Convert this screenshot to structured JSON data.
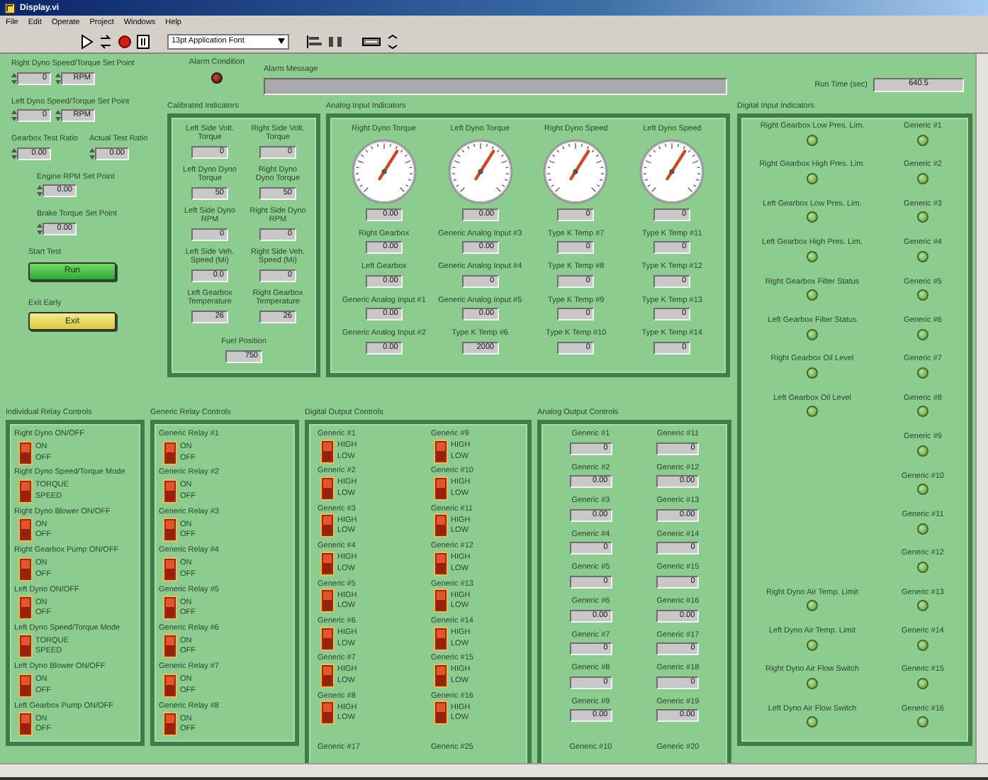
{
  "window": {
    "title": "Display.vi"
  },
  "menu": [
    "File",
    "Edit",
    "Operate",
    "Project",
    "Windows",
    "Help"
  ],
  "toolbar": {
    "font": "13pt Application Font"
  },
  "left_controls": [
    {
      "items": [
        {
          "label": "Right Dyno Speed/Torque Set Point",
          "fields": [
            "0",
            "RPM"
          ]
        }
      ]
    },
    {
      "items": [
        {
          "label": "Left Dyno Speed/Torque Set Point",
          "fields": [
            "0",
            "RPM"
          ]
        }
      ]
    },
    {
      "items": [
        {
          "label": "Gearbox Test Ratio",
          "fields": [
            "0.00"
          ]
        },
        {
          "label": "Actual Test Ratio",
          "fields": [
            "0.00"
          ]
        }
      ]
    },
    {
      "items": [
        {
          "label": "Engine RPM Set Point",
          "fields": [
            "0.00"
          ]
        }
      ]
    },
    {
      "items": [
        {
          "label": "Brake Torque Set Point",
          "fields": [
            "0.00"
          ]
        }
      ]
    }
  ],
  "start": {
    "label": "Start Test",
    "button": "Run"
  },
  "exit": {
    "label": "Exit Early",
    "button": "Exit"
  },
  "alarm": {
    "label": "Alarm Condition",
    "on": false
  },
  "alarm_message": {
    "label": "Alarm Message"
  },
  "run_time": {
    "label": "Run Time (sec)",
    "value": "640.5"
  },
  "calibrated": {
    "title": "Calibrated Indicators",
    "pairs": [
      [
        {
          "label": "Left Side Volt. Torque",
          "value": "0"
        },
        {
          "label": "Right Side Volt. Torque",
          "value": "0"
        }
      ],
      [
        {
          "label": "Left Dyno Dyno Torque",
          "value": "50"
        },
        {
          "label": "Right Dyno Dyno Torque",
          "value": "50"
        }
      ],
      [
        {
          "label": "Left Side Dyno RPM",
          "value": "0"
        },
        {
          "label": "Right Side Dyno RPM",
          "value": "0"
        }
      ],
      [
        {
          "label": "Left Side Veh. Speed (Mi)",
          "value": "0.0"
        },
        {
          "label": "Right Side Veh. Speed (Mi)",
          "value": "0"
        }
      ],
      [
        {
          "label": "Left Gearbox Temperature",
          "value": "26"
        },
        {
          "label": "Right Gearbox Temperature",
          "value": "26"
        }
      ]
    ],
    "footer": {
      "label": "Fuel Position",
      "value": "750"
    }
  },
  "analog_inputs": {
    "title": "Analog Input Indicators",
    "gauges": [
      {
        "label": "Right Dyno Torque",
        "value": "0.00"
      },
      {
        "label": "Left Dyno Torque",
        "value": "0.00"
      },
      {
        "label": "Right Dyno Speed",
        "value": "0"
      },
      {
        "label": "Left Dyno Speed",
        "value": "0"
      }
    ],
    "readouts": [
      {
        "label": "Right Gearbox",
        "value": "0.00"
      },
      {
        "label": "Generic Analog Input #3",
        "value": "0.00"
      },
      {
        "label": "Type K Temp #7",
        "value": "0"
      },
      {
        "label": "Type K Temp #11",
        "value": "0"
      },
      {
        "label": "Left Gearbox",
        "value": "0.00"
      },
      {
        "label": "Generic Analog Input #4",
        "value": "0"
      },
      {
        "label": "Type K Temp #8",
        "value": "0"
      },
      {
        "label": "Type K Temp #12",
        "value": "0"
      },
      {
        "label": "Generic Analog Input #1",
        "value": "0.00"
      },
      {
        "label": "Generic Analog Input #5",
        "value": "0.00"
      },
      {
        "label": "Type K Temp #9",
        "value": "0"
      },
      {
        "label": "Type K Temp #13",
        "value": "0"
      },
      {
        "label": "Generic Analog Input #2",
        "value": "0.00"
      },
      {
        "label": "Type K Temp #6",
        "value": "2000"
      },
      {
        "label": "Type K Temp #10",
        "value": "0"
      },
      {
        "label": "Type K Temp #14",
        "value": "0"
      }
    ]
  },
  "digital_inputs": {
    "title": "Digital Input Indicators",
    "rows": [
      {
        "left": {
          "label": "Right Gearbox Low Pres. Lim.",
          "on": false
        },
        "right": {
          "label": "Generic #1",
          "on": false
        }
      },
      {
        "left": {
          "label": "Right Gearbox High Pres. Lim.",
          "on": false
        },
        "right": {
          "label": "Generic #2",
          "on": false
        }
      },
      {
        "left": {
          "label": "Left Gearbox Low Pres. Lim.",
          "on": false
        },
        "right": {
          "label": "Generic #3",
          "on": false
        }
      },
      {
        "left": {
          "label": "Left Gearbox High Pres. Lim.",
          "on": false
        },
        "right": {
          "label": "Generic #4",
          "on": false
        }
      },
      {
        "left": {
          "label": "Right Gearbox Filter Status",
          "on": false
        },
        "right": {
          "label": "Generic #5",
          "on": false
        }
      },
      {
        "left": {
          "label": "Left Gearbox Filter Status",
          "on": false
        },
        "right": {
          "label": "Generic #6",
          "on": false
        }
      },
      {
        "left": {
          "label": "Right Gearbox Oil Level",
          "on": false
        },
        "right": {
          "label": "Generic #7",
          "on": false
        }
      },
      {
        "left": {
          "label": "Left Gearbox Oil Level",
          "on": false
        },
        "right": {
          "label": "Generic #8",
          "on": false
        }
      },
      {
        "right": {
          "label": "Generic #9",
          "on": false
        }
      },
      {
        "right": {
          "label": "Generic #10",
          "on": false
        }
      },
      {
        "right": {
          "label": "Generic #11",
          "on": false
        }
      },
      {
        "right": {
          "label": "Generic #12",
          "on": false
        }
      },
      {
        "left": {
          "label": "Right Dyno Air Temp. Limit",
          "on": false
        },
        "right": {
          "label": "Generic #13",
          "on": false
        }
      },
      {
        "left": {
          "label": "Left Dyno Air Temp. Limit",
          "on": false
        },
        "right": {
          "label": "Generic #14",
          "on": false
        }
      },
      {
        "left": {
          "label": "Right Dyno Air Flow Switch",
          "on": false
        },
        "right": {
          "label": "Generic #15",
          "on": false
        }
      },
      {
        "left": {
          "label": "Left Dyno Air Flow Switch",
          "on": false
        },
        "right": {
          "label": "Generic #16",
          "on": false
        }
      }
    ]
  },
  "individual_relays": {
    "title": "Individual Relay Controls",
    "items": [
      {
        "label": "Right Dyno ON/OFF",
        "on_text": "ON",
        "off_text": "OFF",
        "on": false
      },
      {
        "label": "Right Dyno Speed/Torque Mode",
        "on_text": "TORQUE",
        "off_text": "SPEED",
        "on": false
      },
      {
        "label": "Right Dyno Blower ON/OFF",
        "on_text": "ON",
        "off_text": "OFF",
        "on": false
      },
      {
        "label": "Right Gearbox Pump ON/OFF",
        "on_text": "ON",
        "off_text": "OFF",
        "on": false
      },
      {
        "label": "Left Dyno ON/OFF",
        "on_text": "ON",
        "off_text": "OFF",
        "on": false
      },
      {
        "label": "Left Dyno Speed/Torque Mode",
        "on_text": "TORQUE",
        "off_text": "SPEED",
        "on": false
      },
      {
        "label": "Left Dyno Blower ON/OFF",
        "on_text": "ON",
        "off_text": "OFF",
        "on": false
      },
      {
        "label": "Left Gearbox Pump ON/OFF",
        "on_text": "ON",
        "off_text": "OFF",
        "on": false
      }
    ]
  },
  "generic_relays": {
    "title": "Generic Relay Controls",
    "items": [
      {
        "label": "Generic Relay #1",
        "on_text": "ON",
        "off_text": "OFF",
        "on": false
      },
      {
        "label": "Generic Relay #2",
        "on_text": "ON",
        "off_text": "OFF",
        "on": false
      },
      {
        "label": "Generic Relay #3",
        "on_text": "ON",
        "off_text": "OFF",
        "on": false
      },
      {
        "label": "Generic Relay #4",
        "on_text": "ON",
        "off_text": "OFF",
        "on": false
      },
      {
        "label": "Generic Relay #5",
        "on_text": "ON",
        "off_text": "OFF",
        "on": false
      },
      {
        "label": "Generic Relay #6",
        "on_text": "ON",
        "off_text": "OFF",
        "on": false
      },
      {
        "label": "Generic Relay #7",
        "on_text": "ON",
        "off_text": "OFF",
        "on": false
      },
      {
        "label": "Generic Relay #8",
        "on_text": "ON",
        "off_text": "OFF",
        "on": false
      }
    ]
  },
  "digital_outputs": {
    "title": "Digital Output Controls",
    "columns": [
      [
        {
          "kind": "switch",
          "label": "Generic #1",
          "on_text": "HIGH",
          "off_text": "LOW",
          "on": false
        },
        {
          "kind": "switch",
          "label": "Generic #2",
          "on_text": "HIGH",
          "off_text": "LOW",
          "on": false
        },
        {
          "kind": "switch",
          "label": "Generic #3",
          "on_text": "HIGH",
          "off_text": "LOW",
          "on": false
        },
        {
          "kind": "switch",
          "label": "Generic #4",
          "on_text": "HIGH",
          "off_text": "LOW",
          "on": false
        },
        {
          "kind": "switch",
          "label": "Generic #5",
          "on_text": "HIGH",
          "off_text": "LOW",
          "on": false
        },
        {
          "kind": "switch",
          "label": "Generic #6",
          "on_text": "HIGH",
          "off_text": "LOW",
          "on": false
        },
        {
          "kind": "switch",
          "label": "Generic #7",
          "on_text": "HIGH",
          "off_text": "LOW",
          "on": false
        },
        {
          "kind": "switch",
          "label": "Generic #8",
          "on_text": "HIGH",
          "off_text": "LOW",
          "on": false
        },
        {
          "kind": "label",
          "label": "Generic #17"
        }
      ],
      [
        {
          "kind": "switch",
          "label": "Generic #9",
          "on_text": "HIGH",
          "off_text": "LOW",
          "on": false
        },
        {
          "kind": "switch",
          "label": "Generic #10",
          "on_text": "HIGH",
          "off_text": "LOW",
          "on": false
        },
        {
          "kind": "switch",
          "label": "Generic #11",
          "on_text": "HIGH",
          "off_text": "LOW",
          "on": false
        },
        {
          "kind": "switch",
          "label": "Generic #12",
          "on_text": "HIGH",
          "off_text": "LOW",
          "on": false
        },
        {
          "kind": "switch",
          "label": "Generic #13",
          "on_text": "HIGH",
          "off_text": "LOW",
          "on": false
        },
        {
          "kind": "switch",
          "label": "Generic #14",
          "on_text": "HIGH",
          "off_text": "LOW",
          "on": false
        },
        {
          "kind": "switch",
          "label": "Generic #15",
          "on_text": "HIGH",
          "off_text": "LOW",
          "on": false
        },
        {
          "kind": "switch",
          "label": "Generic #16",
          "on_text": "HIGH",
          "off_text": "LOW",
          "on": false
        },
        {
          "kind": "label",
          "label": "Generic #25"
        }
      ]
    ]
  },
  "analog_outputs": {
    "title": "Analog Output Controls",
    "columns": [
      [
        {
          "kind": "numeric",
          "label": "Generic #1",
          "value": "0"
        },
        {
          "kind": "numeric",
          "label": "Generic #2",
          "value": "0.00"
        },
        {
          "kind": "numeric",
          "label": "Generic #3",
          "value": "0.00"
        },
        {
          "kind": "numeric",
          "label": "Generic #4",
          "value": "0"
        },
        {
          "kind": "numeric",
          "label": "Generic #5",
          "value": "0"
        },
        {
          "kind": "numeric",
          "label": "Generic #6",
          "value": "0.00"
        },
        {
          "kind": "numeric",
          "label": "Generic #7",
          "value": "0"
        },
        {
          "kind": "numeric",
          "label": "Generic #8",
          "value": "0"
        },
        {
          "kind": "numeric",
          "label": "Generic #9",
          "value": "0.00"
        },
        {
          "kind": "label",
          "label": "Generic #10"
        }
      ],
      [
        {
          "kind": "numeric",
          "label": "Generic #11",
          "value": "0"
        },
        {
          "kind": "numeric",
          "label": "Generic #12",
          "value": "0.00"
        },
        {
          "kind": "numeric",
          "label": "Generic #13",
          "value": "0.00"
        },
        {
          "kind": "numeric",
          "label": "Generic #14",
          "value": "0"
        },
        {
          "kind": "numeric",
          "label": "Generic #15",
          "value": "0"
        },
        {
          "kind": "numeric",
          "label": "Generic #16",
          "value": "0.00"
        },
        {
          "kind": "numeric",
          "label": "Generic #17",
          "value": "0"
        },
        {
          "kind": "numeric",
          "label": "Generic #18",
          "value": "0"
        },
        {
          "kind": "numeric",
          "label": "Generic #19",
          "value": "0.00"
        },
        {
          "kind": "label",
          "label": "Generic #20"
        }
      ]
    ]
  }
}
